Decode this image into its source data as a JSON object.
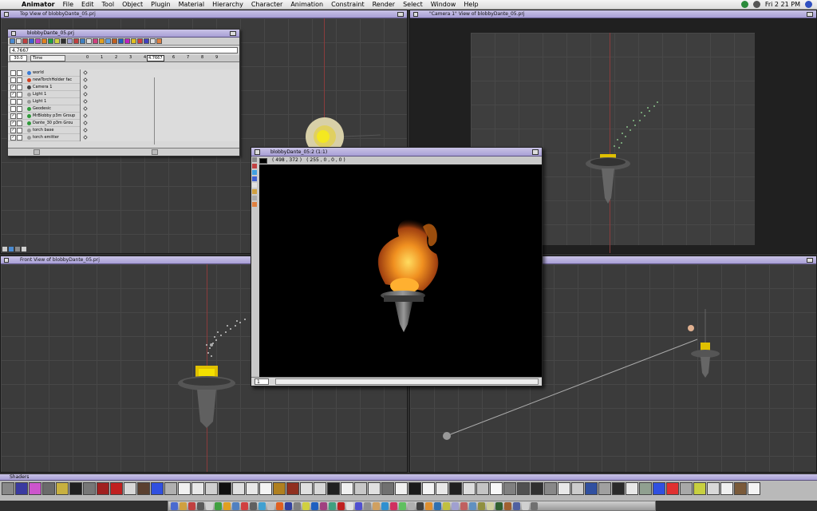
{
  "menubar": {
    "app": "Animator",
    "items": [
      "File",
      "Edit",
      "Tool",
      "Object",
      "Plugin",
      "Material",
      "Hierarchy",
      "Character",
      "Animation",
      "Constraint",
      "Render",
      "Select",
      "Window",
      "Help"
    ],
    "clock": "Fri 2 21 PM"
  },
  "viewports": {
    "top_title": "Top View of blobbyDante_05.prj",
    "camera_title": "\"Camera 1\" View of blobbyDante_05.prj",
    "front_title": "Front View of blobbyDante_05.prj",
    "right_title": ""
  },
  "timeline": {
    "title": "blobbyDante_05.prj",
    "value_field": "4.7667",
    "fps": "30.0",
    "time_selector": "Time",
    "current_time": "4.7667",
    "ticks": [
      "0",
      "1",
      "2",
      "3",
      "4",
      "5",
      "6",
      "7",
      "8",
      "9"
    ],
    "rows": [
      {
        "name": "world",
        "color": "#3a7bd5",
        "checked": false
      },
      {
        "name": "newTorchHolder fac",
        "color": "#d04020",
        "checked": false
      },
      {
        "name": "Camera 1",
        "color": "#444444",
        "checked": true
      },
      {
        "name": "Light 1",
        "color": "#999999",
        "checked": true
      },
      {
        "name": "Light 1",
        "color": "#999999",
        "checked": false
      },
      {
        "name": "Geodesic",
        "color": "#2f9a3a",
        "checked": false
      },
      {
        "name": "MrBlobby p3m Group",
        "color": "#2f9a3a",
        "checked": true
      },
      {
        "name": "Dante_30 p3m Grou",
        "color": "#2f9a3a",
        "checked": true
      },
      {
        "name": "torch base",
        "color": "#999999",
        "checked": true
      },
      {
        "name": "torch emitter",
        "color": "#999999",
        "checked": true
      }
    ]
  },
  "render_window": {
    "title": "blobbyDante_05:2 (1:1)",
    "coords": "( 498 , 372 )",
    "rgb": "( 255 , 0 , 0 , 0 )",
    "page": "1"
  },
  "shaders": {
    "title": "Shaders",
    "swatch_colors": [
      "#888888",
      "#3a3aa0",
      "#cc55cc",
      "#6a6a6a",
      "#c8b040",
      "#202020",
      "#777777",
      "#a02020",
      "#c02020",
      "#d8d8d8",
      "#5a4030",
      "#3050e0",
      "#b0b0b0",
      "#f0f0f0",
      "#e8e8e8",
      "#d0d0d0",
      "#101010",
      "#e0e0e0",
      "#e8e8e8",
      "#f4f4f4",
      "#b08020",
      "#903020",
      "#e0e0e0",
      "#d8d8d8",
      "#202020",
      "#f0f0f0",
      "#c8c8c8",
      "#e0e0e0",
      "#707070",
      "#f0f0f0",
      "#1a1a1a",
      "#f4f4f4",
      "#e8e8e8",
      "#202020",
      "#dddddd",
      "#c4c4c4",
      "#f8f8f8",
      "#808080",
      "#505050",
      "#303030",
      "#888888",
      "#e8e8e8",
      "#cccccc",
      "#3050a0",
      "#a0a0a0",
      "#2a2a2a",
      "#e8e8e8",
      "#90a090",
      "#3050e0",
      "#e03030",
      "#a8a8a8",
      "#c8d040",
      "#d8d8d8",
      "#f0f0f0",
      "#7a5a3a",
      "#f4f4f4"
    ]
  },
  "dock_colors": [
    "#4a6ad0",
    "#d0a040",
    "#c04040",
    "#5a5a5a",
    "#d0d0d0",
    "#40a040",
    "#e0a020",
    "#5080c0",
    "#d04040",
    "#606060",
    "#40a0d0",
    "#c0c0c0",
    "#e06020",
    "#3040a0",
    "#808080",
    "#d0d040",
    "#2060c0",
    "#a04080",
    "#40a080",
    "#c02020",
    "#e0e0e0",
    "#5050d0",
    "#909090",
    "#d0a060",
    "#3090d0",
    "#d03060",
    "#60c060",
    "#b0b0b0",
    "#404040",
    "#e09030",
    "#3070b0",
    "#c0c040",
    "#a0a0d0",
    "#c06060",
    "#6090c0",
    "#909040",
    "#d0d0a0",
    "#306030",
    "#a06030",
    "#5060a0",
    "#d0d0d0",
    "#707070"
  ]
}
